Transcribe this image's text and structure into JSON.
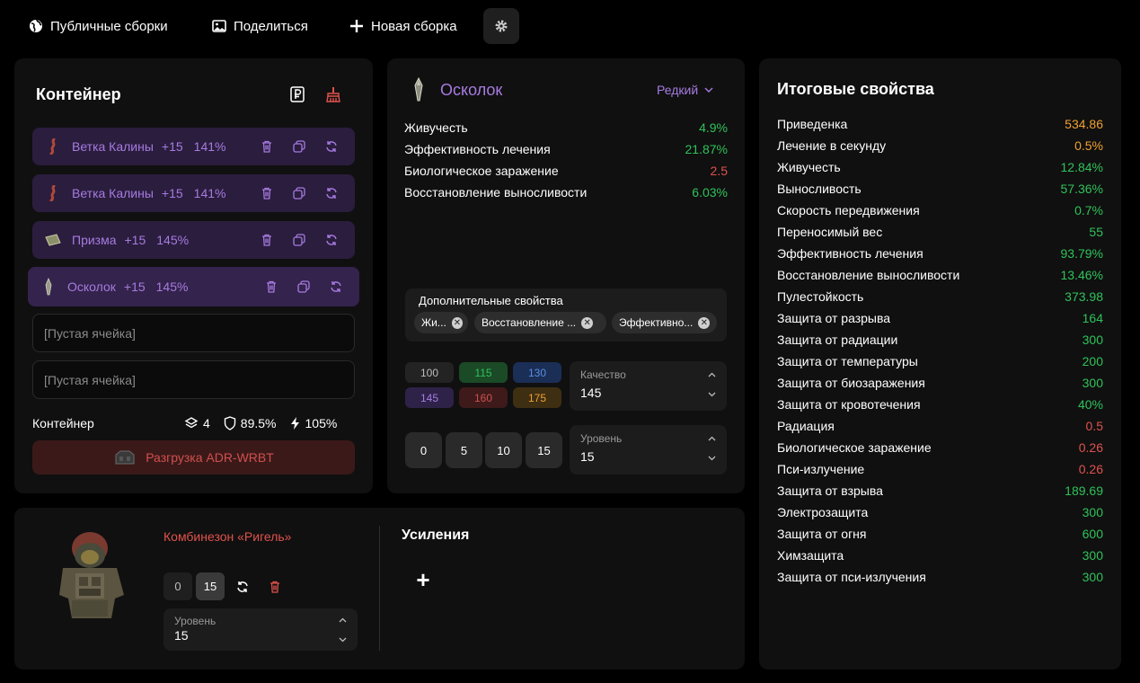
{
  "nav": {
    "public_builds": "Публичные сборки",
    "share": "Поделиться",
    "new_build": "Новая сборка"
  },
  "container": {
    "title": "Контейнер",
    "slots": [
      {
        "name": "Ветка Калины",
        "plus": "+15",
        "percent": "141%"
      },
      {
        "name": "Ветка Калины",
        "plus": "+15",
        "percent": "141%"
      },
      {
        "name": "Призма",
        "plus": "+15",
        "percent": "145%"
      },
      {
        "name": "Осколок",
        "plus": "+15",
        "percent": "145%"
      }
    ],
    "empty_slot": "[Пустая ячейка]",
    "footer_label": "Контейнер",
    "capacity": "4",
    "protection": "89.5%",
    "efficiency": "105%",
    "unload_label": "Разгрузка ADR-WRBT"
  },
  "artefact": {
    "name": "Осколок",
    "rarity": "Редкий",
    "props": [
      {
        "label": "Живучесть",
        "value": "4.9%",
        "color": "#2fc25a"
      },
      {
        "label": "Эффективность лечения",
        "value": "21.87%",
        "color": "#2fc25a"
      },
      {
        "label": "Биологическое заражение",
        "value": "2.5",
        "color": "#e0524d"
      },
      {
        "label": "Восстановление выносливости",
        "value": "6.03%",
        "color": "#2fc25a"
      }
    ],
    "extra_title": "Дополнительные свойства",
    "chips": [
      "Жи...",
      "Восстановление ...",
      "Эффективно..."
    ],
    "quality_buttons": [
      "100",
      "115",
      "130",
      "145",
      "160",
      "175"
    ],
    "quality_label": "Качество",
    "quality_value": "145",
    "level_buttons": [
      "0",
      "5",
      "10",
      "15"
    ],
    "level_label": "Уровень",
    "level_value": "15"
  },
  "suit": {
    "name": "Комбинезон «Ригель»",
    "btn_0": "0",
    "btn_15": "15",
    "level_label": "Уровень",
    "level_value": "15",
    "boosts_title": "Усиления",
    "add_boost": "+"
  },
  "totals": {
    "title": "Итоговые свойства",
    "rows": [
      {
        "label": "Приведенка",
        "value": "534.86",
        "color": "#f0a030"
      },
      {
        "label": "Лечение в секунду",
        "value": "0.5%",
        "color": "#f0a030"
      },
      {
        "label": "Живучесть",
        "value": "12.84%",
        "color": "#2fc25a"
      },
      {
        "label": "Выносливость",
        "value": "57.36%",
        "color": "#2fc25a"
      },
      {
        "label": "Скорость передвижения",
        "value": "0.7%",
        "color": "#2fc25a"
      },
      {
        "label": "Переносимый вес",
        "value": "55",
        "color": "#2fc25a"
      },
      {
        "label": "Эффективность лечения",
        "value": "93.79%",
        "color": "#2fc25a"
      },
      {
        "label": "Восстановление выносливости",
        "value": "13.46%",
        "color": "#2fc25a"
      },
      {
        "label": "Пулестойкость",
        "value": "373.98",
        "color": "#2fc25a"
      },
      {
        "label": "Защита от разрыва",
        "value": "164",
        "color": "#2fc25a"
      },
      {
        "label": "Защита от радиации",
        "value": "300",
        "color": "#2fc25a"
      },
      {
        "label": "Защита от температуры",
        "value": "200",
        "color": "#2fc25a"
      },
      {
        "label": "Защита от биозаражения",
        "value": "300",
        "color": "#2fc25a"
      },
      {
        "label": "Защита от кровотечения",
        "value": "40%",
        "color": "#2fc25a"
      },
      {
        "label": "Радиация",
        "value": "0.5",
        "color": "#e0524d"
      },
      {
        "label": "Биологическое заражение",
        "value": "0.26",
        "color": "#e0524d"
      },
      {
        "label": "Пси-излучение",
        "value": "0.26",
        "color": "#e0524d"
      },
      {
        "label": "Защита от взрыва",
        "value": "189.69",
        "color": "#2fc25a"
      },
      {
        "label": "Электрозащита",
        "value": "300",
        "color": "#2fc25a"
      },
      {
        "label": "Защита от огня",
        "value": "600",
        "color": "#2fc25a"
      },
      {
        "label": "Химзащита",
        "value": "300",
        "color": "#2fc25a"
      },
      {
        "label": "Защита от пси-излучения",
        "value": "300",
        "color": "#2fc25a"
      }
    ]
  }
}
